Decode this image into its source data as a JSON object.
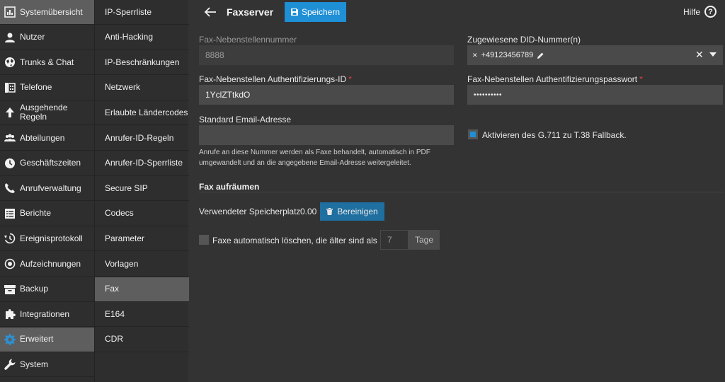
{
  "nav_primary": [
    {
      "label": "Systemübersicht",
      "icon": "dashboard-icon",
      "active": true
    },
    {
      "label": "Nutzer",
      "icon": "user-icon"
    },
    {
      "label": "Trunks & Chat",
      "icon": "globe-icon"
    },
    {
      "label": "Telefone",
      "icon": "phone-device-icon"
    },
    {
      "label": "Ausgehende Regeln",
      "icon": "arrow-up-icon"
    },
    {
      "label": "Abteilungen",
      "icon": "group-icon"
    },
    {
      "label": "Geschäftszeiten",
      "icon": "clock-icon"
    },
    {
      "label": "Anrufverwaltung",
      "icon": "phone-icon"
    },
    {
      "label": "Berichte",
      "icon": "report-icon"
    },
    {
      "label": "Ereignisprotokoll",
      "icon": "history-icon"
    },
    {
      "label": "Aufzeichnungen",
      "icon": "record-icon"
    },
    {
      "label": "Backup",
      "icon": "archive-icon"
    },
    {
      "label": "Integrationen",
      "icon": "puzzle-icon"
    },
    {
      "label": "Erweitert",
      "icon": "gear-icon",
      "active": true,
      "accent": "#2f8fd0"
    },
    {
      "label": "System",
      "icon": "wrench-icon"
    }
  ],
  "nav_secondary": [
    {
      "label": "IP-Sperrliste"
    },
    {
      "label": "Anti-Hacking"
    },
    {
      "label": "IP-Beschränkungen"
    },
    {
      "label": "Netzwerk"
    },
    {
      "label": "Erlaubte Ländercodes"
    },
    {
      "label": "Anrufer-ID-Regeln"
    },
    {
      "label": "Anrufer-ID-Sperrliste"
    },
    {
      "label": "Secure SIP"
    },
    {
      "label": "Codecs"
    },
    {
      "label": "Parameter"
    },
    {
      "label": "Vorlagen"
    },
    {
      "label": "Fax",
      "active": true
    },
    {
      "label": "E164"
    },
    {
      "label": "CDR"
    }
  ],
  "header": {
    "title": "Faxserver",
    "save_label": "Speichern",
    "help_label": "Hilfe",
    "help_glyph": "?"
  },
  "form": {
    "extension_label": "Fax-Nebenstellennummer",
    "extension_value": "8888",
    "did_label": "Zugewiesene DID-Nummer(n)",
    "did_chip": "+49123456789",
    "auth_id_label": "Fax-Nebenstellen Authentifizierungs-ID",
    "auth_id_value": "1YclZTtkdO",
    "auth_pw_label": "Fax-Nebenstellen Authentifizierungspasswort",
    "auth_pw_value": "••••••••••",
    "email_label": "Standard Email-Adresse",
    "email_value": "",
    "email_hint": "Anrufe an diese Nummer werden als Faxe behandelt, automatisch in PDF umgewandelt und an die angegebene Email-Adresse weitergeleitet.",
    "g711_label": "Aktivieren des G.711 zu T.38 Fallback.",
    "g711_checked": true,
    "required_mark": "*"
  },
  "cleanup": {
    "title": "Fax aufräumen",
    "storage_label": "Verwendeter Speicherplatz",
    "storage_value": "0.00",
    "clean_button": "Bereinigen",
    "auto_delete_label": "Faxe automatisch löschen, die älter sind als",
    "auto_delete_checked": false,
    "days_value": "7",
    "days_unit": "Tage"
  },
  "colors": {
    "accent": "#1f8fd6",
    "required": "#e04040"
  }
}
